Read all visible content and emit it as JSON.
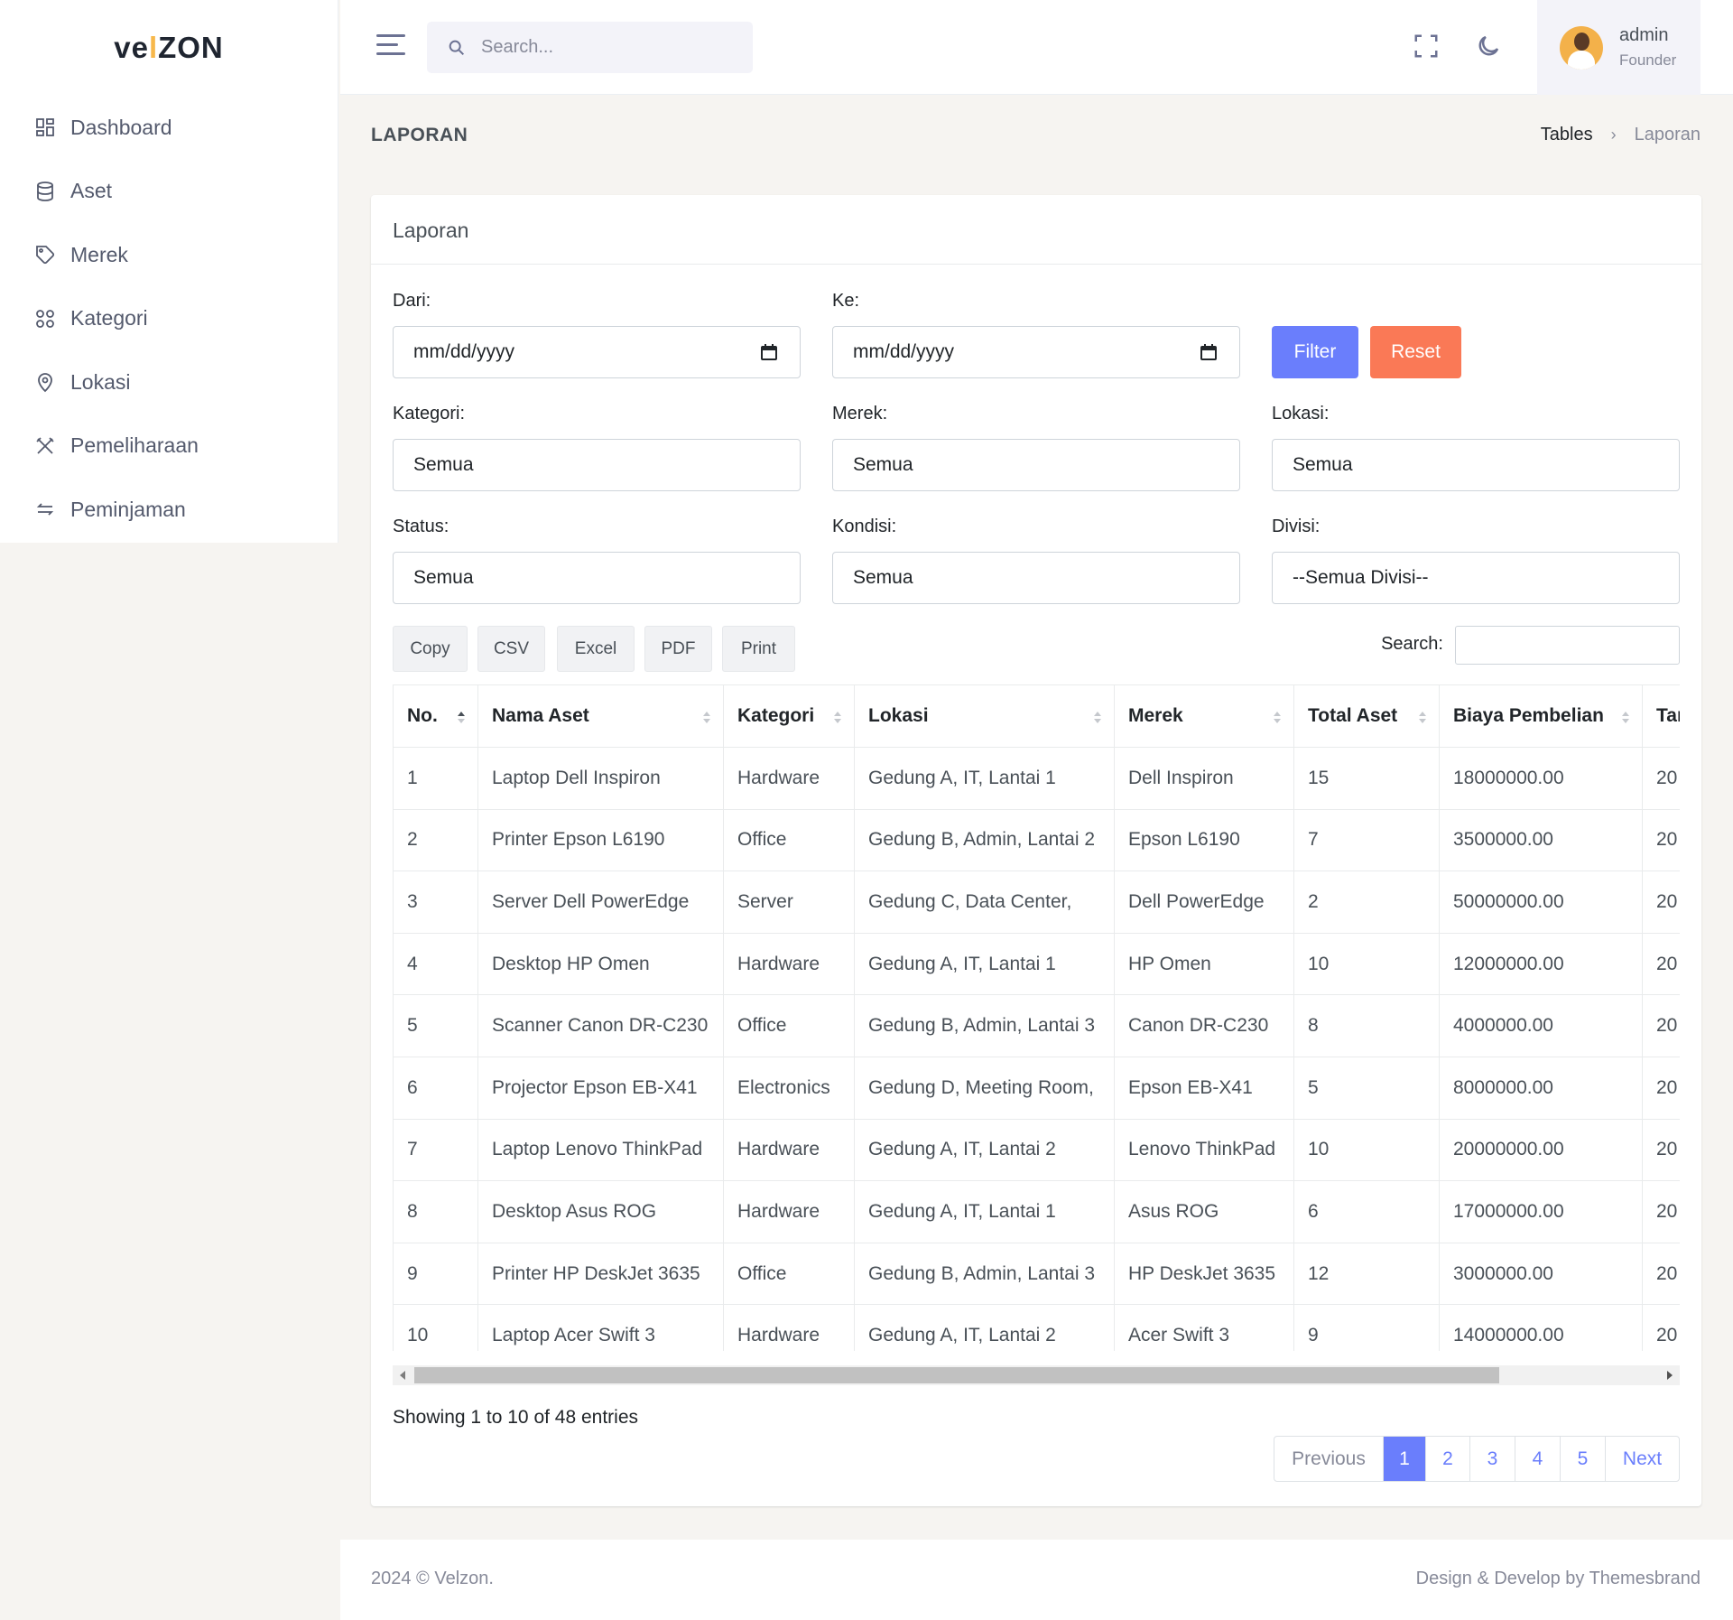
{
  "brand": {
    "pre": "ve",
    "dot": "l",
    "post": "ZON"
  },
  "sidebar": {
    "items": [
      {
        "label": "Dashboard",
        "icon": "dashboard-icon"
      },
      {
        "label": "Aset",
        "icon": "database-icon"
      },
      {
        "label": "Merek",
        "icon": "tag-icon"
      },
      {
        "label": "Kategori",
        "icon": "grid-icon"
      },
      {
        "label": "Lokasi",
        "icon": "map-pin-icon"
      },
      {
        "label": "Pemeliharaan",
        "icon": "tools-icon"
      },
      {
        "label": "Peminjaman",
        "icon": "swap-icon"
      }
    ]
  },
  "topbar": {
    "search_placeholder": "Search...",
    "user_name": "admin",
    "user_role": "Founder"
  },
  "page": {
    "title": "LAPORAN",
    "breadcrumb": [
      "Tables",
      "Laporan"
    ]
  },
  "card": {
    "title": "Laporan",
    "filters": {
      "dari_label": "Dari:",
      "dari_value": "mm/dd/yyyy",
      "ke_label": "Ke:",
      "ke_value": "mm/dd/yyyy",
      "filter_button": "Filter",
      "reset_button": "Reset",
      "kategori_label": "Kategori:",
      "kategori_value": "Semua",
      "merek_label": "Merek:",
      "merek_value": "Semua",
      "lokasi_label": "Lokasi:",
      "lokasi_value": "Semua",
      "status_label": "Status:",
      "status_value": "Semua",
      "kondisi_label": "Kondisi:",
      "kondisi_value": "Semua",
      "divisi_label": "Divisi:",
      "divisi_value": "--Semua Divisi--"
    },
    "export_buttons": [
      "Copy",
      "CSV",
      "Excel",
      "PDF",
      "Print"
    ],
    "search_label": "Search:",
    "table": {
      "headers": [
        "No.",
        "Nama Aset",
        "Kategori",
        "Lokasi",
        "Merek",
        "Total Aset",
        "Biaya Pembelian",
        "Tanggal"
      ],
      "rows": [
        [
          "1",
          "Laptop Dell Inspiron",
          "Hardware",
          "Gedung A, IT, Lantai 1",
          "Dell Inspiron",
          "15",
          "18000000.00",
          "20"
        ],
        [
          "2",
          "Printer Epson L6190",
          "Office",
          "Gedung B, Admin, Lantai 2",
          "Epson L6190",
          "7",
          "3500000.00",
          "20"
        ],
        [
          "3",
          "Server Dell PowerEdge",
          "Server",
          "Gedung C, Data Center,",
          "Dell PowerEdge",
          "2",
          "50000000.00",
          "20"
        ],
        [
          "4",
          "Desktop HP Omen",
          "Hardware",
          "Gedung A, IT, Lantai 1",
          "HP Omen",
          "10",
          "12000000.00",
          "20"
        ],
        [
          "5",
          "Scanner Canon DR-C230",
          "Office",
          "Gedung B, Admin, Lantai 3",
          "Canon DR-C230",
          "8",
          "4000000.00",
          "20"
        ],
        [
          "6",
          "Projector Epson EB-X41",
          "Electronics",
          "Gedung D, Meeting Room,",
          "Epson EB-X41",
          "5",
          "8000000.00",
          "20"
        ],
        [
          "7",
          "Laptop Lenovo ThinkPad",
          "Hardware",
          "Gedung A, IT, Lantai 2",
          "Lenovo ThinkPad",
          "10",
          "20000000.00",
          "20"
        ],
        [
          "8",
          "Desktop Asus ROG",
          "Hardware",
          "Gedung A, IT, Lantai 1",
          "Asus ROG",
          "6",
          "17000000.00",
          "20"
        ],
        [
          "9",
          "Printer HP DeskJet 3635",
          "Office",
          "Gedung B, Admin, Lantai 3",
          "HP DeskJet 3635",
          "12",
          "3000000.00",
          "20"
        ],
        [
          "10",
          "Laptop Acer Swift 3",
          "Hardware",
          "Gedung A, IT, Lantai 2",
          "Acer Swift 3",
          "9",
          "14000000.00",
          "20"
        ]
      ]
    },
    "info": "Showing 1 to 10 of 48 entries",
    "pagination": [
      "Previous",
      "1",
      "2",
      "3",
      "4",
      "5",
      "Next"
    ],
    "active_page": "1"
  },
  "footer": {
    "left": "2024 © Velzon.",
    "right": "Design & Develop by Themesbrand"
  },
  "colors": {
    "primary": "#6a7efc",
    "danger": "#fa7956",
    "sidebar_text": "#545a6d"
  }
}
